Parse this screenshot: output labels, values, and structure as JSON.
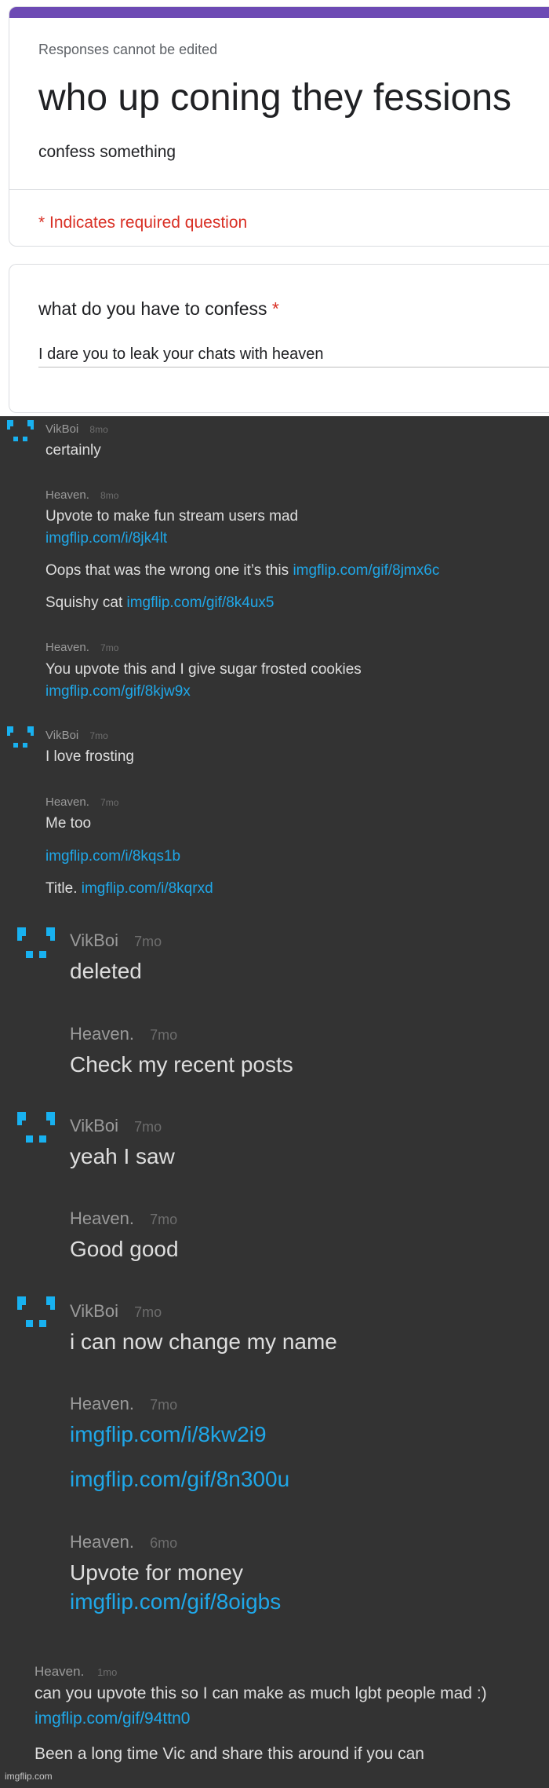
{
  "form": {
    "responses_note": "Responses cannot be edited",
    "title": "who up coning they fessions",
    "description": "confess something",
    "required_note": "* Indicates required question",
    "question": {
      "label": "what do you have to confess",
      "required_star": "*",
      "answer": "I dare you to leak your chats with heaven"
    }
  },
  "chat": {
    "blocks": [
      {
        "author": "VikBoi",
        "time": "8mo",
        "lines": [
          {
            "text": "certainly"
          }
        ]
      },
      {
        "author": "Heaven.",
        "time": "8mo",
        "lines": [
          {
            "text": "Upvote to make fun stream users mad"
          },
          {
            "link": "imgflip.com/i/8jk4lt"
          },
          {
            "text": "Oops that was the wrong one it’s this ",
            "link": "imgflip.com/gif/8jmx6c"
          },
          {
            "text": "Squishy cat ",
            "link": "imgflip.com/gif/8k4ux5"
          }
        ]
      },
      {
        "author": "Heaven.",
        "time": "7mo",
        "lines": [
          {
            "text": "You upvote this and I give sugar frosted cookies"
          },
          {
            "link": "imgflip.com/gif/8kjw9x"
          }
        ]
      },
      {
        "author": "VikBoi",
        "time": "7mo",
        "lines": [
          {
            "text": "I love frosting"
          }
        ]
      },
      {
        "author": "Heaven.",
        "time": "7mo",
        "lines": [
          {
            "text": "Me too"
          },
          {
            "link": "imgflip.com/i/8kqs1b"
          },
          {
            "text": "Title. ",
            "link": "imgflip.com/i/8kqrxd"
          }
        ]
      },
      {
        "author": "VikBoi",
        "time": "7mo",
        "lines": [
          {
            "text": "deleted"
          }
        ]
      },
      {
        "author": "Heaven.",
        "time": "7mo",
        "lines": [
          {
            "text": "Check my recent posts"
          }
        ]
      },
      {
        "author": "VikBoi",
        "time": "7mo",
        "lines": [
          {
            "text": "yeah I saw"
          }
        ]
      },
      {
        "author": "Heaven.",
        "time": "7mo",
        "lines": [
          {
            "text": "Good good"
          }
        ]
      },
      {
        "author": "VikBoi",
        "time": "7mo",
        "lines": [
          {
            "text": "i can now change my name"
          }
        ]
      },
      {
        "author": "Heaven.",
        "time": "7mo",
        "lines": [
          {
            "link": "imgflip.com/i/8kw2i9"
          },
          {
            "link": "imgflip.com/gif/8n300u"
          }
        ]
      },
      {
        "author": "Heaven.",
        "time": "6mo",
        "lines": [
          {
            "text": "Upvote for money"
          },
          {
            "link": "imgflip.com/gif/8oigbs"
          }
        ]
      },
      {
        "author": "Heaven.",
        "time": "1mo",
        "lines": [
          {
            "text": "can you upvote this so I can make as much lgbt people mad :)"
          },
          {
            "link": "imgflip.com/gif/94ttn0"
          },
          {
            "text": "Been a long time Vic and share this around if you can"
          }
        ]
      }
    ]
  },
  "watermark": "imgflip.com",
  "colors": {
    "form_accent": "#6d4ab4",
    "required_red": "#d93025",
    "chat_background": "#333333",
    "link_blue": "#1fa7e8",
    "avatar_blue": "#18b1f0"
  }
}
